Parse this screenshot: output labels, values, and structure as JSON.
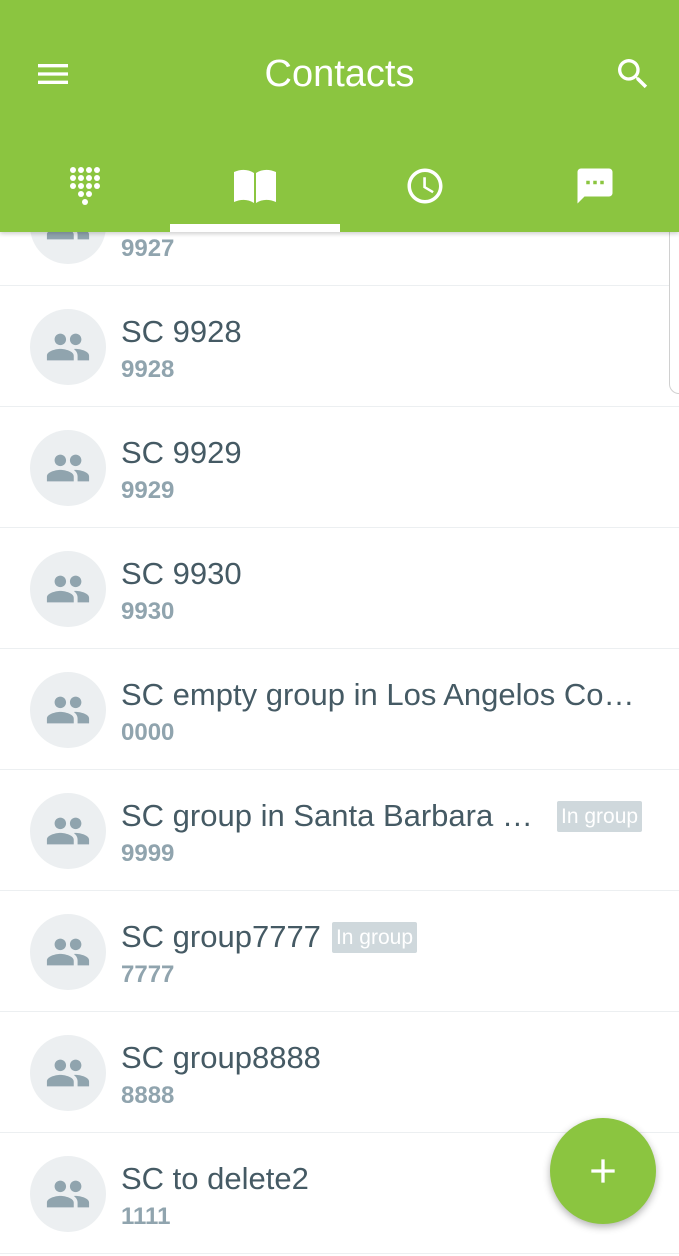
{
  "header": {
    "title": "Contacts",
    "color": "#8bc540",
    "menu_icon": "menu-icon",
    "search_icon": "search-icon"
  },
  "tabs": [
    {
      "icon": "dialpad-icon",
      "selected": false
    },
    {
      "icon": "contacts-book-icon",
      "selected": true
    },
    {
      "icon": "recent-clock-icon",
      "selected": false
    },
    {
      "icon": "chat-icon",
      "selected": false
    }
  ],
  "contacts": [
    {
      "name": "",
      "number": "9927"
    },
    {
      "name": "SC 9928",
      "number": "9928"
    },
    {
      "name": "SC 9929",
      "number": "9929"
    },
    {
      "name": "SC 9930",
      "number": "9930"
    },
    {
      "name": "SC empty group in Los Angelos County",
      "number": "0000"
    },
    {
      "name": "SC group in Santa Barbara County",
      "number": "9999",
      "badge": "In group"
    },
    {
      "name": "SC group7777",
      "number": "7777",
      "badge": "In group"
    },
    {
      "name": "SC group8888",
      "number": "8888"
    },
    {
      "name": "SC to delete2",
      "number": "1111"
    }
  ],
  "fab": {
    "icon": "add-icon"
  }
}
